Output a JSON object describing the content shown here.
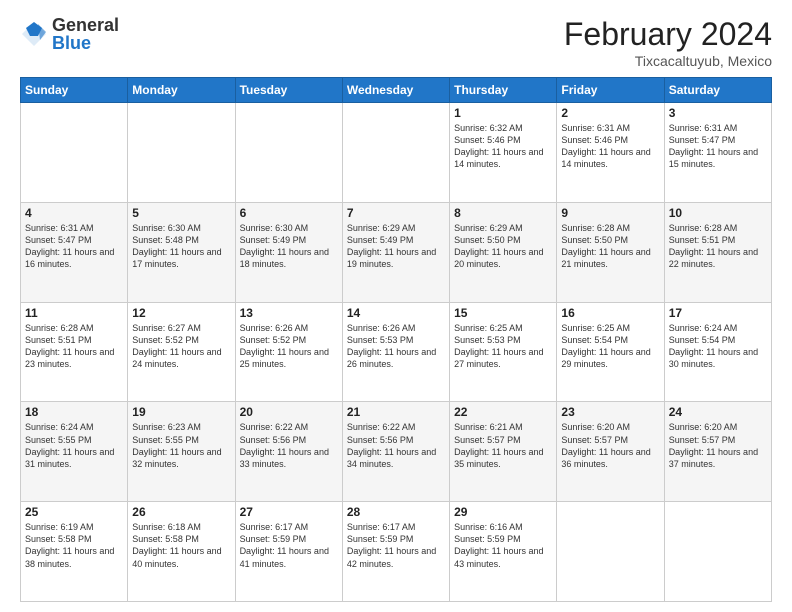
{
  "logo": {
    "general": "General",
    "blue": "Blue"
  },
  "title": {
    "month": "February 2024",
    "location": "Tixcacaltuyub, Mexico"
  },
  "days_of_week": [
    "Sunday",
    "Monday",
    "Tuesday",
    "Wednesday",
    "Thursday",
    "Friday",
    "Saturday"
  ],
  "weeks": [
    [
      {
        "day": "",
        "info": ""
      },
      {
        "day": "",
        "info": ""
      },
      {
        "day": "",
        "info": ""
      },
      {
        "day": "",
        "info": ""
      },
      {
        "day": "1",
        "info": "Sunrise: 6:32 AM\nSunset: 5:46 PM\nDaylight: 11 hours and 14 minutes."
      },
      {
        "day": "2",
        "info": "Sunrise: 6:31 AM\nSunset: 5:46 PM\nDaylight: 11 hours and 14 minutes."
      },
      {
        "day": "3",
        "info": "Sunrise: 6:31 AM\nSunset: 5:47 PM\nDaylight: 11 hours and 15 minutes."
      }
    ],
    [
      {
        "day": "4",
        "info": "Sunrise: 6:31 AM\nSunset: 5:47 PM\nDaylight: 11 hours and 16 minutes."
      },
      {
        "day": "5",
        "info": "Sunrise: 6:30 AM\nSunset: 5:48 PM\nDaylight: 11 hours and 17 minutes."
      },
      {
        "day": "6",
        "info": "Sunrise: 6:30 AM\nSunset: 5:49 PM\nDaylight: 11 hours and 18 minutes."
      },
      {
        "day": "7",
        "info": "Sunrise: 6:29 AM\nSunset: 5:49 PM\nDaylight: 11 hours and 19 minutes."
      },
      {
        "day": "8",
        "info": "Sunrise: 6:29 AM\nSunset: 5:50 PM\nDaylight: 11 hours and 20 minutes."
      },
      {
        "day": "9",
        "info": "Sunrise: 6:28 AM\nSunset: 5:50 PM\nDaylight: 11 hours and 21 minutes."
      },
      {
        "day": "10",
        "info": "Sunrise: 6:28 AM\nSunset: 5:51 PM\nDaylight: 11 hours and 22 minutes."
      }
    ],
    [
      {
        "day": "11",
        "info": "Sunrise: 6:28 AM\nSunset: 5:51 PM\nDaylight: 11 hours and 23 minutes."
      },
      {
        "day": "12",
        "info": "Sunrise: 6:27 AM\nSunset: 5:52 PM\nDaylight: 11 hours and 24 minutes."
      },
      {
        "day": "13",
        "info": "Sunrise: 6:26 AM\nSunset: 5:52 PM\nDaylight: 11 hours and 25 minutes."
      },
      {
        "day": "14",
        "info": "Sunrise: 6:26 AM\nSunset: 5:53 PM\nDaylight: 11 hours and 26 minutes."
      },
      {
        "day": "15",
        "info": "Sunrise: 6:25 AM\nSunset: 5:53 PM\nDaylight: 11 hours and 27 minutes."
      },
      {
        "day": "16",
        "info": "Sunrise: 6:25 AM\nSunset: 5:54 PM\nDaylight: 11 hours and 29 minutes."
      },
      {
        "day": "17",
        "info": "Sunrise: 6:24 AM\nSunset: 5:54 PM\nDaylight: 11 hours and 30 minutes."
      }
    ],
    [
      {
        "day": "18",
        "info": "Sunrise: 6:24 AM\nSunset: 5:55 PM\nDaylight: 11 hours and 31 minutes."
      },
      {
        "day": "19",
        "info": "Sunrise: 6:23 AM\nSunset: 5:55 PM\nDaylight: 11 hours and 32 minutes."
      },
      {
        "day": "20",
        "info": "Sunrise: 6:22 AM\nSunset: 5:56 PM\nDaylight: 11 hours and 33 minutes."
      },
      {
        "day": "21",
        "info": "Sunrise: 6:22 AM\nSunset: 5:56 PM\nDaylight: 11 hours and 34 minutes."
      },
      {
        "day": "22",
        "info": "Sunrise: 6:21 AM\nSunset: 5:57 PM\nDaylight: 11 hours and 35 minutes."
      },
      {
        "day": "23",
        "info": "Sunrise: 6:20 AM\nSunset: 5:57 PM\nDaylight: 11 hours and 36 minutes."
      },
      {
        "day": "24",
        "info": "Sunrise: 6:20 AM\nSunset: 5:57 PM\nDaylight: 11 hours and 37 minutes."
      }
    ],
    [
      {
        "day": "25",
        "info": "Sunrise: 6:19 AM\nSunset: 5:58 PM\nDaylight: 11 hours and 38 minutes."
      },
      {
        "day": "26",
        "info": "Sunrise: 6:18 AM\nSunset: 5:58 PM\nDaylight: 11 hours and 40 minutes."
      },
      {
        "day": "27",
        "info": "Sunrise: 6:17 AM\nSunset: 5:59 PM\nDaylight: 11 hours and 41 minutes."
      },
      {
        "day": "28",
        "info": "Sunrise: 6:17 AM\nSunset: 5:59 PM\nDaylight: 11 hours and 42 minutes."
      },
      {
        "day": "29",
        "info": "Sunrise: 6:16 AM\nSunset: 5:59 PM\nDaylight: 11 hours and 43 minutes."
      },
      {
        "day": "",
        "info": ""
      },
      {
        "day": "",
        "info": ""
      }
    ]
  ]
}
